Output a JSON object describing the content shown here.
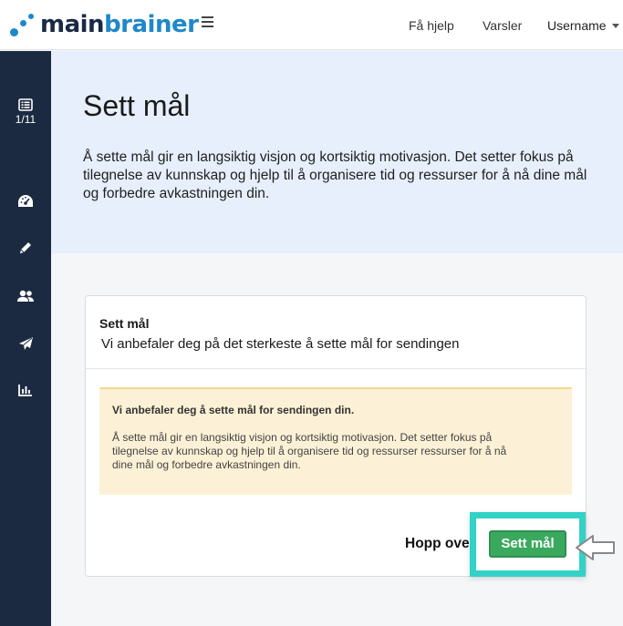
{
  "topbar": {
    "logo_part1": "main",
    "logo_part2": "brainer",
    "help_label": "Få hjelp",
    "alerts_label": "Varsler",
    "user_label": "Username"
  },
  "sidebar": {
    "progress": "1/11",
    "items": [
      {
        "name": "list-icon"
      },
      {
        "name": "dashboard-gauge-icon"
      },
      {
        "name": "pencil-icon"
      },
      {
        "name": "users-icon"
      },
      {
        "name": "paper-plane-icon"
      },
      {
        "name": "bar-chart-icon"
      }
    ]
  },
  "hero": {
    "title": "Sett mål",
    "description": "Å sette mål gir en langsiktig visjon og kortsiktig motivasjon. Det setter fokus på tilegnelse av kunnskap og hjelp til å organisere tid og ressurser for å nå dine mål og forbedre avkastningen din."
  },
  "card": {
    "title": "Sett mål",
    "subtitle": "Vi anbefaler deg på det sterkeste å sette mål for sendingen",
    "alert_title": "Vi anbefaler deg å sette mål for sendingen din.",
    "alert_body": "Å sette mål gir en langsiktig visjon og kortsiktig motivasjon. Det setter fokus på tilegnelse av kunnskap og hjelp  til å organisere tid og ressurser ressurser for å nå dine mål og forbedre avkastningen din.",
    "skip_label": "Hopp ove",
    "primary_label": "Sett mål"
  },
  "colors": {
    "brand_dark": "#1a2a44",
    "brand_blue": "#1e88c8",
    "sidebar_bg": "#1c2a41",
    "hero_bg": "#e6effb",
    "alert_bg": "#fcf1d6",
    "primary_button": "#3aa95e",
    "highlight": "#33d2c6"
  }
}
